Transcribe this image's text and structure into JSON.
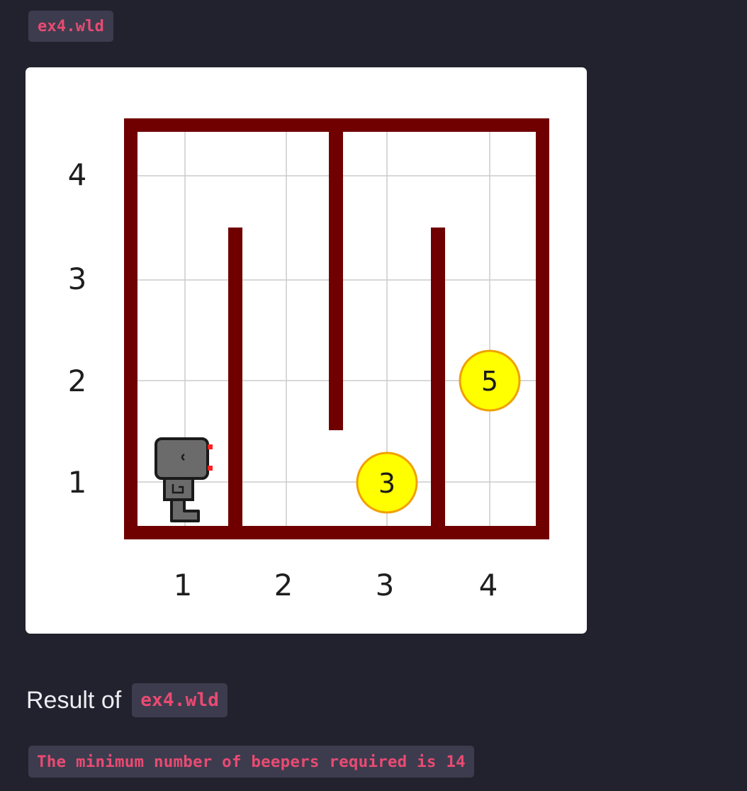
{
  "header": {
    "file_chip": "ex4.wld"
  },
  "world": {
    "columns": 4,
    "rows": 4,
    "x_ticks": [
      "1",
      "2",
      "3",
      "4"
    ],
    "y_ticks": [
      "1",
      "2",
      "3",
      "4"
    ],
    "wall_color": "#700000",
    "grid_color": "#cccccc",
    "beeper_color": "#ffff00",
    "beeper_border_color": "#f0a000",
    "beepers": [
      {
        "avenue": 3,
        "street": 1,
        "count": "3"
      },
      {
        "avenue": 4,
        "street": 2,
        "count": "5"
      }
    ],
    "robot": {
      "avenue": 1,
      "street": 1,
      "facing": "east",
      "icon": "robot-icon"
    }
  },
  "result": {
    "prefix": "Result of",
    "file_chip": "ex4.wld",
    "output": "The minimum number of beepers required is 14"
  },
  "colors": {
    "page_background": "#22222e",
    "chip_background": "#3c3c4e",
    "chip_text": "#ea4a72"
  }
}
